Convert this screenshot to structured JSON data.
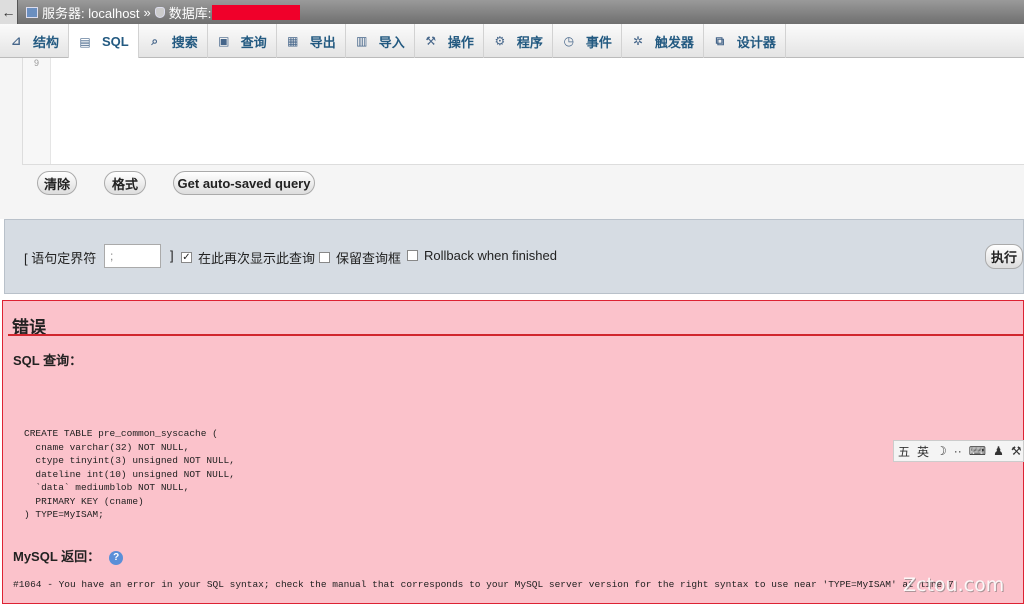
{
  "breadcrumb": {
    "back_label": "←",
    "server_label": "服务器: localhost",
    "separator": "»",
    "database_label": "数据库:"
  },
  "tabs": [
    {
      "label": "结构",
      "icon": "structure-icon"
    },
    {
      "label": "SQL",
      "icon": "sql-icon"
    },
    {
      "label": "搜索",
      "icon": "search-icon"
    },
    {
      "label": "查询",
      "icon": "query-icon"
    },
    {
      "label": "导出",
      "icon": "export-icon"
    },
    {
      "label": "导入",
      "icon": "import-icon"
    },
    {
      "label": "操作",
      "icon": "wrench-icon"
    },
    {
      "label": "程序",
      "icon": "routines-icon"
    },
    {
      "label": "事件",
      "icon": "clock-icon"
    },
    {
      "label": "触发器",
      "icon": "triggers-icon"
    },
    {
      "label": "设计器",
      "icon": "designer-icon"
    }
  ],
  "editor": {
    "line_number": "9"
  },
  "buttons": {
    "clear": "清除",
    "format": "格式",
    "autosaved": "Get auto-saved query",
    "go": "执行"
  },
  "options": {
    "delimiter_label": "[ 语句定界符",
    "delimiter_value": ";",
    "bracket_close": "]",
    "show_again": "在此再次显示此查询",
    "retain_box": "保留查询框",
    "rollback": "Rollback when finished"
  },
  "error": {
    "title": "错误",
    "sql_query_label": "SQL 查询：",
    "sql_code": "CREATE TABLE pre_common_syscache (\n  cname varchar(32) NOT NULL,\n  ctype tinyint(3) unsigned NOT NULL,\n  dateline int(10) unsigned NOT NULL,\n  `data` mediumblob NOT NULL,\n  PRIMARY KEY (cname)\n) TYPE=MyISAM;",
    "mysql_returned_label": "MySQL 返回：",
    "message": "#1064 - You have an error in your SQL syntax; check the manual that corresponds to your MySQL server version for the right syntax to use near 'TYPE=MyISAM' at line 7"
  },
  "ime_toolbar": {
    "lang": "英"
  },
  "watermark": "Zctou.com"
}
